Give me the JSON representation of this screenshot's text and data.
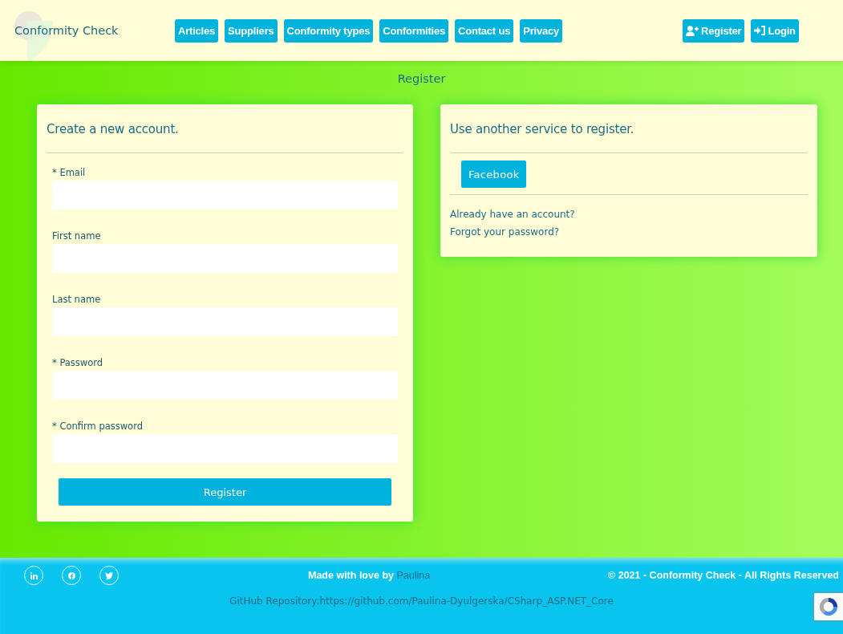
{
  "brand": "Conformity Check",
  "nav": [
    "Articles",
    "Suppliers",
    "Conformity types",
    "Conformities",
    "Contact us",
    "Privacy"
  ],
  "account": [
    {
      "label": "Register",
      "kind": "register"
    },
    {
      "label": "Login",
      "kind": "login"
    }
  ],
  "page_title": "Register",
  "form": {
    "heading": "Create a new account.",
    "fields": [
      {
        "label": "* Email"
      },
      {
        "label": "First name"
      },
      {
        "label": "Last name"
      },
      {
        "label": "* Password"
      },
      {
        "label": "* Confirm password"
      }
    ],
    "submit": "Register"
  },
  "external": {
    "heading": "Use another service to register.",
    "providers": [
      "Facebook"
    ],
    "links": [
      "Already have an account?",
      "Forgot your password?"
    ]
  },
  "footer": {
    "social": [
      {
        "kind": "linkedin"
      },
      {
        "kind": "facebook"
      },
      {
        "kind": "twitter"
      }
    ],
    "made_with": "Made with love by",
    "author": "Paulina",
    "copyright": "© 2021 - Conformity Check - All Rights Reserved",
    "repo": "GitHub Repository:https://github.com/Paulina-Dyulgerska/CSharp_ASP.NET_Core"
  }
}
